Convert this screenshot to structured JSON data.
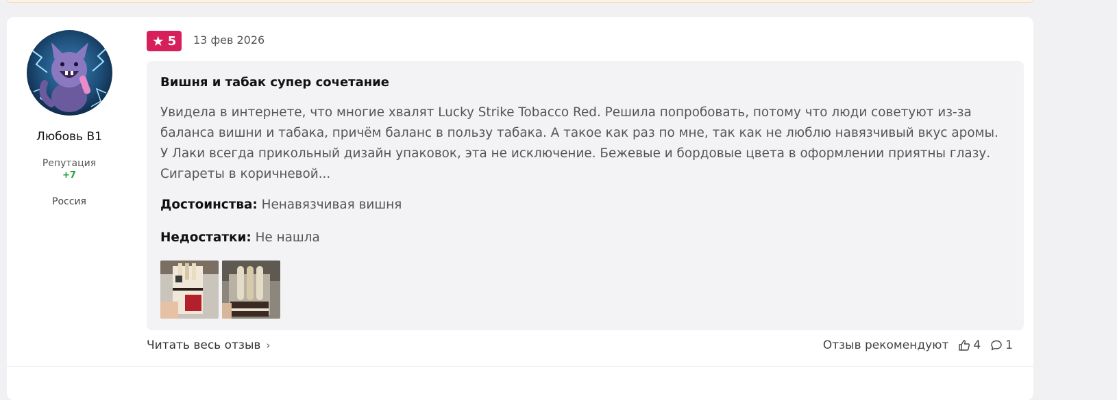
{
  "author": {
    "name": "Любовь В1",
    "reputation_label": "Репутация",
    "reputation_value": "+7",
    "country": "Россия"
  },
  "review": {
    "rating": "5",
    "date": "13 фев 2026",
    "title": "Вишня и табак супер сочетание",
    "text": "Увидела в интернете, что многие хвалят Lucky Strike Tobacco Red. Решила попробовать, потому что люди советуют из-за\nбаланса вишни и табака, причём баланс в пользу табака. А такое как раз по мне, так как не люблю навязчивый вкус аромы.\nУ Лаки всегда прикольный дизайн упаковок, эта не исключение. Бежевые и бордовые цвета в оформлении приятны глазу.\nСигареты в коричневой...",
    "pros_label": "Достоинства:",
    "pros_value": "Ненавязчивая вишня",
    "cons_label": "Недостатки:",
    "cons_value": "Не нашла"
  },
  "footer": {
    "read_more": "Читать весь отзыв",
    "recommend_label": "Отзыв рекомендуют",
    "likes": "4",
    "comments": "1"
  },
  "colors": {
    "rating_badge": "#d61f5b",
    "reputation_positive": "#1aa33a",
    "review_box_bg": "#f3f3f5"
  },
  "icons": {
    "rating": "star-icon",
    "read_more": "chevron-right-icon",
    "likes": "thumbs-up-icon",
    "comments": "comment-bubble-icon"
  }
}
